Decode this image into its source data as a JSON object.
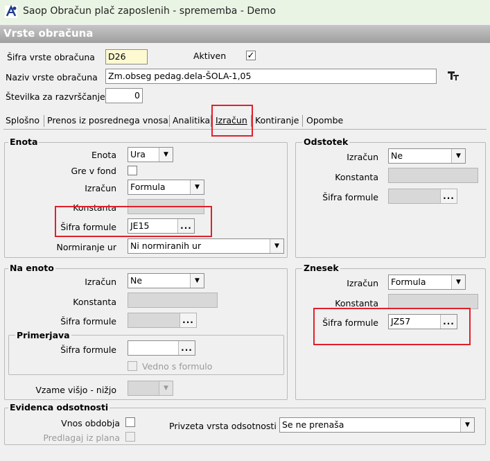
{
  "window": {
    "title": "Saop Obračun plač zaposlenih - sprememba - Demo"
  },
  "form": {
    "title": "Vrste obračuna",
    "sifra_label": "Šifra vrste obračuna",
    "sifra_value": "D26",
    "aktiven_label": "Aktiven",
    "aktiven_checked": true,
    "naziv_label": "Naziv vrste obračuna",
    "naziv_value": "Zm.obseg pedag.dela-ŠOLA-1,05",
    "stevilka_label": "Številka  za razvrščanje",
    "stevilka_value": "0"
  },
  "tabs": [
    {
      "label": "Splošno"
    },
    {
      "label": "Prenos iz posrednega vnosa"
    },
    {
      "label": "Analitika"
    },
    {
      "label": "Izračun"
    },
    {
      "label": "Kontiranje"
    },
    {
      "label": "Opombe"
    }
  ],
  "active_tab": "Izračun",
  "enota": {
    "title": "Enota",
    "enota_label": "Enota",
    "enota_value": "Ura",
    "gre_label": "Gre v fond",
    "gre_checked": false,
    "izracun_label": "Izračun",
    "izracun_value": "Formula",
    "konstanta_label": "Konstanta",
    "sifra_label": "Šifra formule",
    "sifra_value": "JE15",
    "norm_label": "Normiranje ur",
    "norm_value": "Ni normiranih ur"
  },
  "odstotek": {
    "title": "Odstotek",
    "izracun_label": "Izračun",
    "izracun_value": "Ne",
    "konstanta_label": "Konstanta",
    "sifra_label": "Šifra formule",
    "sifra_value": ""
  },
  "na_enoto": {
    "title": "Na enoto",
    "izracun_label": "Izračun",
    "izracun_value": "Ne",
    "konstanta_label": "Konstanta",
    "sifra_label": "Šifra formule",
    "sifra_value": "",
    "primerjava_title": "Primerjava",
    "primerjava_sifra_label": "Šifra formule",
    "vedno_label": "Vedno s formulo",
    "vzame_label": "Vzame višjo - nižjo"
  },
  "znesek": {
    "title": "Znesek",
    "izracun_label": "Izračun",
    "izracun_value": "Formula",
    "konstanta_label": "Konstanta",
    "sifra_label": "Šifra formule",
    "sifra_value": "JZ57"
  },
  "evidenca": {
    "title": "Evidenca odsotnosti",
    "vnos_label": "Vnos obdobja",
    "predlagaj_label": "Predlagaj iz plana",
    "privzeta_label": "Privzeta vrsta odsotnosti",
    "privzeta_value": "Se ne prenaša"
  },
  "icons": {
    "ellipsis": "...",
    "dropdown": "▼",
    "check": "✓"
  },
  "colors": {
    "highlight": "#e0202a",
    "title_gradient_from": "#c6c6c6",
    "titlebar_bg": "#eaf4e4"
  }
}
